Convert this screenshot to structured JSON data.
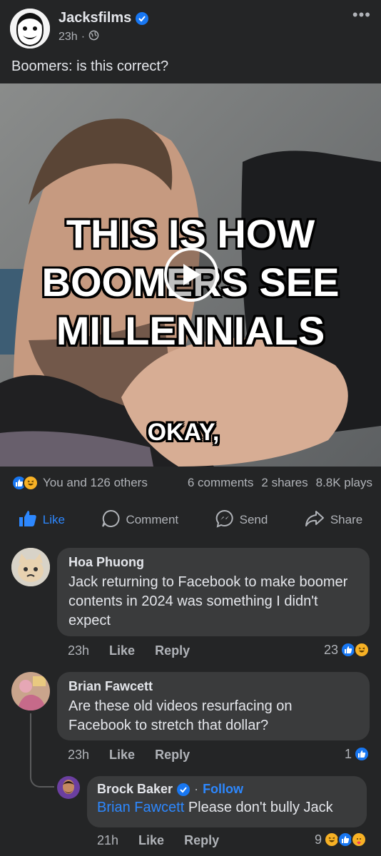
{
  "post": {
    "author": "Jacksfilms",
    "time": "23h",
    "separator": "·",
    "caption": "Boomers: is this correct?",
    "more_label": "•••"
  },
  "video": {
    "overlay_line1": "THIS IS HOW",
    "overlay_line2": "BOOMERS SEE",
    "overlay_line3": "MILLENNIALS",
    "subtitle": "OKAY,"
  },
  "stats": {
    "reactions_text": "You and 126 others",
    "comments": "6 comments",
    "shares": "2 shares",
    "plays": "8.8K plays"
  },
  "actions": {
    "like": "Like",
    "comment": "Comment",
    "send": "Send",
    "share": "Share"
  },
  "comments": [
    {
      "name": "Hoa Phuong",
      "text": "Jack returning to Facebook to make boomer contents in 2024 was something I didn't expect",
      "time": "23h",
      "like": "Like",
      "reply": "Reply",
      "reaction_count": "23"
    },
    {
      "name": "Brian Fawcett",
      "text": "Are these old videos resurfacing on Facebook to stretch that dollar?",
      "time": "23h",
      "like": "Like",
      "reply": "Reply",
      "reaction_count": "1"
    }
  ],
  "reply": {
    "name": "Brock Baker",
    "separator": "·",
    "follow": "Follow",
    "mention": "Brian Fawcett",
    "text": " Please don't bully Jack",
    "time": "21h",
    "like": "Like",
    "reply": "Reply",
    "reaction_count": "9"
  },
  "colors": {
    "background": "#242526",
    "bubble": "#3a3b3c",
    "accent": "#2d88ff",
    "secondary_text": "#b0b3b8"
  }
}
